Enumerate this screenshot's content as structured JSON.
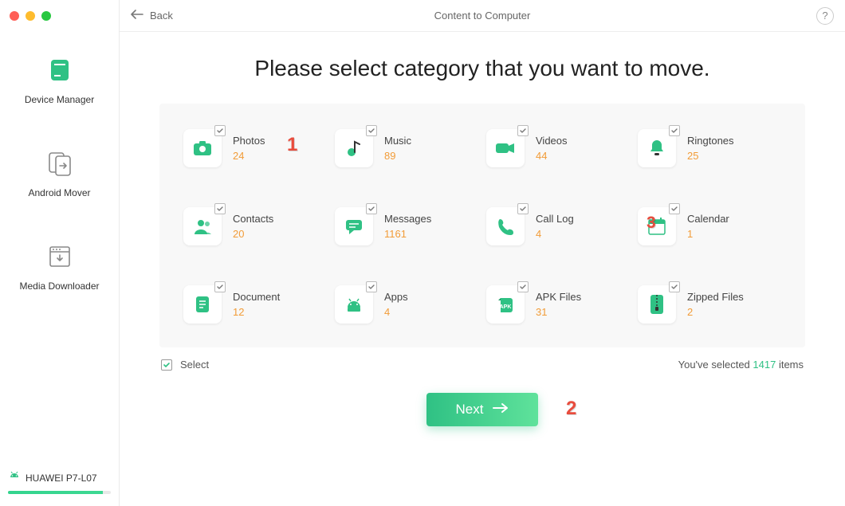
{
  "window": {
    "title": "Content to Computer",
    "back_label": "Back"
  },
  "sidebar": {
    "items": [
      {
        "id": "device-manager",
        "label": "Device Manager"
      },
      {
        "id": "android-mover",
        "label": "Android Mover"
      },
      {
        "id": "media-downloader",
        "label": "Media Downloader"
      }
    ],
    "device": {
      "name": "HUAWEI P7-L07"
    }
  },
  "headline": "Please select category that you want to move.",
  "categories": [
    {
      "id": "photos",
      "label": "Photos",
      "count": "24"
    },
    {
      "id": "music",
      "label": "Music",
      "count": "89"
    },
    {
      "id": "videos",
      "label": "Videos",
      "count": "44"
    },
    {
      "id": "ringtones",
      "label": "Ringtones",
      "count": "25"
    },
    {
      "id": "contacts",
      "label": "Contacts",
      "count": "20"
    },
    {
      "id": "messages",
      "label": "Messages",
      "count": "1161"
    },
    {
      "id": "calllog",
      "label": "Call Log",
      "count": "4"
    },
    {
      "id": "calendar",
      "label": "Calendar",
      "count": "1"
    },
    {
      "id": "document",
      "label": "Document",
      "count": "12"
    },
    {
      "id": "apps",
      "label": "Apps",
      "count": "4"
    },
    {
      "id": "apk",
      "label": "APK Files",
      "count": "31"
    },
    {
      "id": "zipped",
      "label": "Zipped Files",
      "count": "2"
    }
  ],
  "select_all_label": "Select",
  "summary": {
    "prefix": "You've selected ",
    "count": "1417",
    "suffix": " items"
  },
  "next_label": "Next",
  "annotations": {
    "one": "1",
    "two": "2",
    "three": "3"
  },
  "colors": {
    "accent": "#2fc184",
    "count": "#f29c38",
    "annotation": "#e84c3d"
  }
}
